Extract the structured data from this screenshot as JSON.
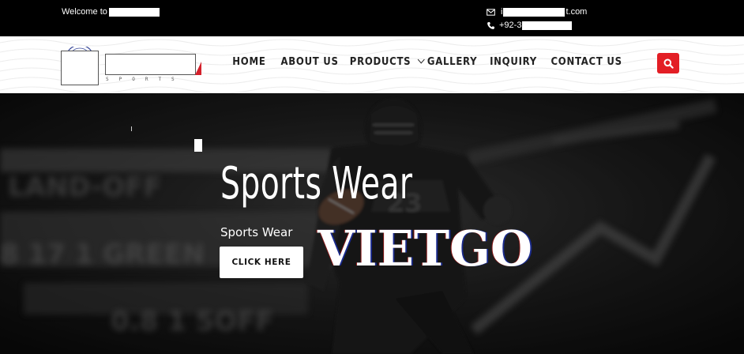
{
  "topbar": {
    "welcome": "Welcome to",
    "email_prefix": "i",
    "email_suffix": "t.com",
    "phone_prefix": "+92-3"
  },
  "logo": {
    "subtitle": "SPORTS"
  },
  "nav": {
    "items": [
      {
        "label": "HOME"
      },
      {
        "label": "ABOUT US"
      },
      {
        "label": "PRODUCTS"
      },
      {
        "label": "GALLERY"
      },
      {
        "label": "INQUIRY"
      },
      {
        "label": "CONTACT US"
      }
    ]
  },
  "icons": {
    "email": "envelope-icon",
    "phone": "phone-icon",
    "search": "search-icon",
    "dropdown": "chevron-down-icon"
  },
  "colors": {
    "accent": "#e31e25",
    "topbar": "#000000",
    "header": "#ffffff"
  },
  "hero": {
    "title": "Sports Wear",
    "subtitle": "Sports Wear",
    "button": "CLICK HERE",
    "watermark": "VIETGO"
  }
}
